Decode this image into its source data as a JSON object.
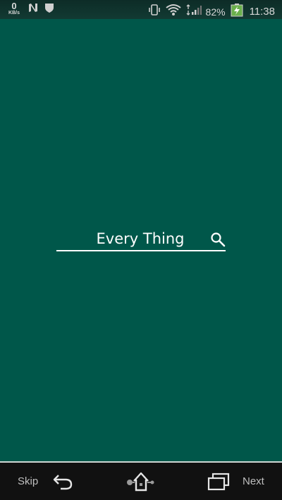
{
  "status_bar": {
    "data_rate": "0",
    "data_unit": "KB/s",
    "battery_percent": "82%",
    "time": "11:38",
    "icons": [
      "n-icon",
      "shield-icon",
      "vibrate-icon",
      "wifi-icon",
      "signal-icon",
      "battery-charging-icon"
    ]
  },
  "search": {
    "value": "Every Thing",
    "icon": "search-icon"
  },
  "nav_bar": {
    "skip_label": "Skip",
    "next_label": "Next",
    "icons": [
      "back-icon",
      "home-icon",
      "recent-apps-icon"
    ]
  },
  "colors": {
    "background": "#00574a",
    "status_bar": "#0d2c27",
    "nav_bar": "#111111",
    "text": "#ffffff",
    "underline": "#ffffff"
  }
}
